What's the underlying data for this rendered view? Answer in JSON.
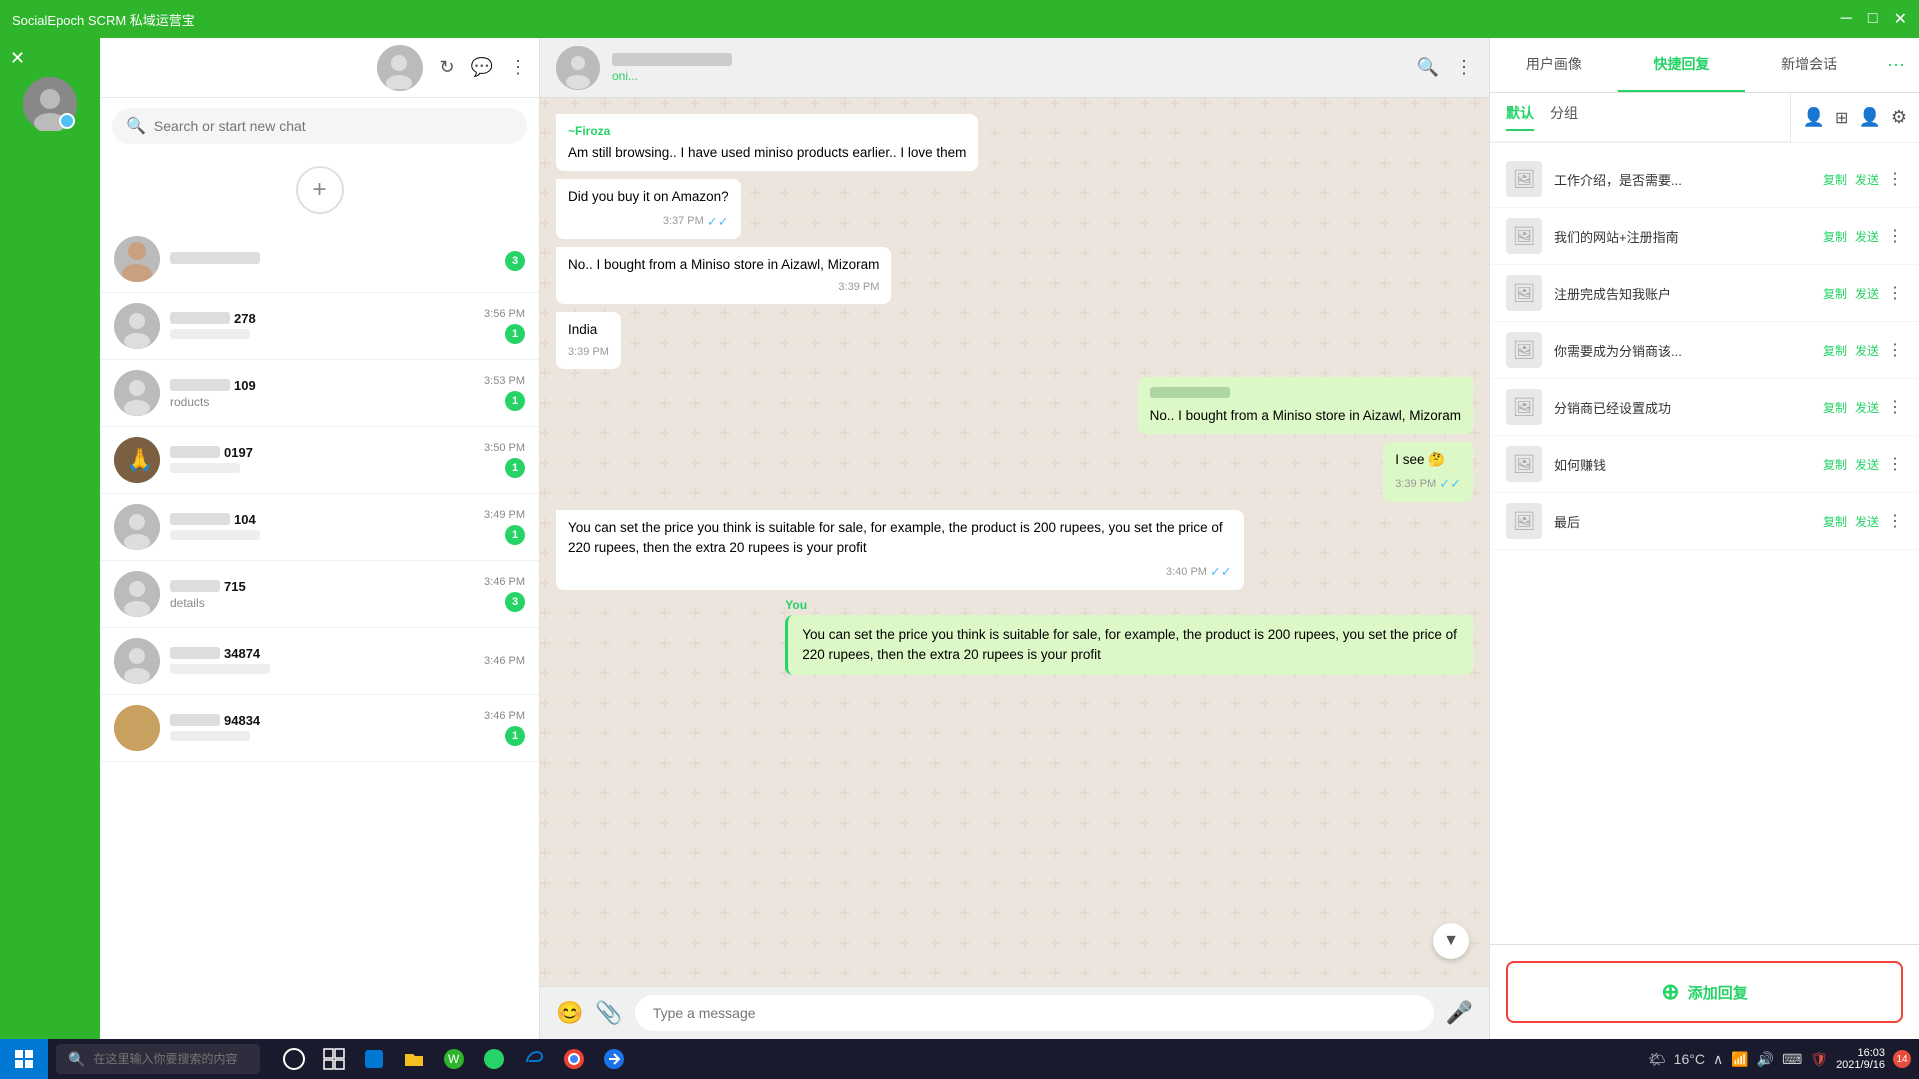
{
  "app": {
    "title": "SocialEpoch SCRM 私域运营宝",
    "controls": {
      "minimize": "─",
      "maximize": "□",
      "close": "✕"
    }
  },
  "sidebar": {
    "close_icon": "✕"
  },
  "chat_list": {
    "search_placeholder": "Search or start new chat",
    "items": [
      {
        "id": 1,
        "name": "blurred",
        "preview": "",
        "time": "",
        "badge": 3,
        "has_image": true
      },
      {
        "id": 2,
        "name": "····278",
        "preview": "",
        "time": "3:56 PM",
        "badge": 1,
        "has_image": false
      },
      {
        "id": 3,
        "name": "····109",
        "preview": "roducts",
        "time": "3:53 PM",
        "badge": 1,
        "has_image": false
      },
      {
        "id": 4,
        "name": "····0197",
        "preview": "",
        "time": "3:50 PM",
        "badge": 1,
        "has_image": true
      },
      {
        "id": 5,
        "name": "····104",
        "preview": "",
        "time": "3:49 PM",
        "badge": 1,
        "has_image": false
      },
      {
        "id": 6,
        "name": "····715",
        "preview": "details",
        "time": "3:46 PM",
        "badge": 3,
        "has_image": false
      },
      {
        "id": 7,
        "name": "····34874",
        "preview": "",
        "time": "3:46 PM",
        "badge": 0,
        "has_image": false
      },
      {
        "id": 8,
        "name": "····94834",
        "preview": "",
        "time": "3:46 PM",
        "badge": 1,
        "has_image": true
      }
    ]
  },
  "chat_header": {
    "name": "blurred contact",
    "status": "online"
  },
  "messages": [
    {
      "id": 1,
      "type": "received",
      "sender": "~Firoza",
      "text": "Am still browsing.. I have used miniso products earlier.. I love them",
      "time": "",
      "show_check": false
    },
    {
      "id": 2,
      "type": "received",
      "sender": "",
      "text": "Did you buy it on Amazon?",
      "time": "3:37 PM",
      "show_check": true
    },
    {
      "id": 3,
      "type": "received_plain",
      "text": "No.. I bought from a Miniso store in Aizawl, Mizoram",
      "time": "3:39 PM",
      "show_check": false
    },
    {
      "id": 4,
      "type": "received_plain",
      "text": "India",
      "time": "3:39 PM",
      "show_check": false
    },
    {
      "id": 5,
      "type": "sent",
      "sender": "",
      "text": "No.. I bought from a Miniso store in Aizawl, Mizoram",
      "time": "",
      "show_check": false
    },
    {
      "id": 6,
      "type": "sent",
      "sender": "",
      "text": "I see 🤔",
      "time": "3:39 PM",
      "show_check": true
    },
    {
      "id": 7,
      "type": "received_plain",
      "text": "You can set the price you think is suitable for sale, for example, the product is 200 rupees, you set the price of 220 rupees, then the extra 20 rupees is your profit",
      "time": "3:40 PM",
      "show_check": true
    },
    {
      "id": 8,
      "type": "you_bubble",
      "label": "You",
      "text": "You can set the price you think is suitable for sale, for example, the product is 200 rupees, you set the price of 220 rupees, then the extra 20 rupees is your profit",
      "time": "",
      "show_check": false
    }
  ],
  "message_input": {
    "placeholder": "Type a message"
  },
  "right_panel": {
    "tabs": [
      "用户画像",
      "快捷回复",
      "新增会话"
    ],
    "active_tab": 1,
    "sub_tabs": [
      "默认",
      "分组"
    ],
    "active_sub_tab": 0,
    "quick_replies": [
      {
        "id": 1,
        "text": "工作介绍，是否需要..."
      },
      {
        "id": 2,
        "text": "我们的网站+注册指南"
      },
      {
        "id": 3,
        "text": "注册完成告知我账户"
      },
      {
        "id": 4,
        "text": "你需要成为分销商该..."
      },
      {
        "id": 5,
        "text": "分销商已经设置成功"
      },
      {
        "id": 6,
        "text": "如何赚钱"
      },
      {
        "id": 7,
        "text": "最后"
      }
    ],
    "add_reply_label": "添加回复",
    "copy_label": "复制",
    "send_label": "发送"
  },
  "taskbar": {
    "search_placeholder": "在这里输入你要搜索的内容",
    "time": "16:03",
    "date": "2021/9/16",
    "notification_count": "14",
    "temp": "16°C"
  }
}
